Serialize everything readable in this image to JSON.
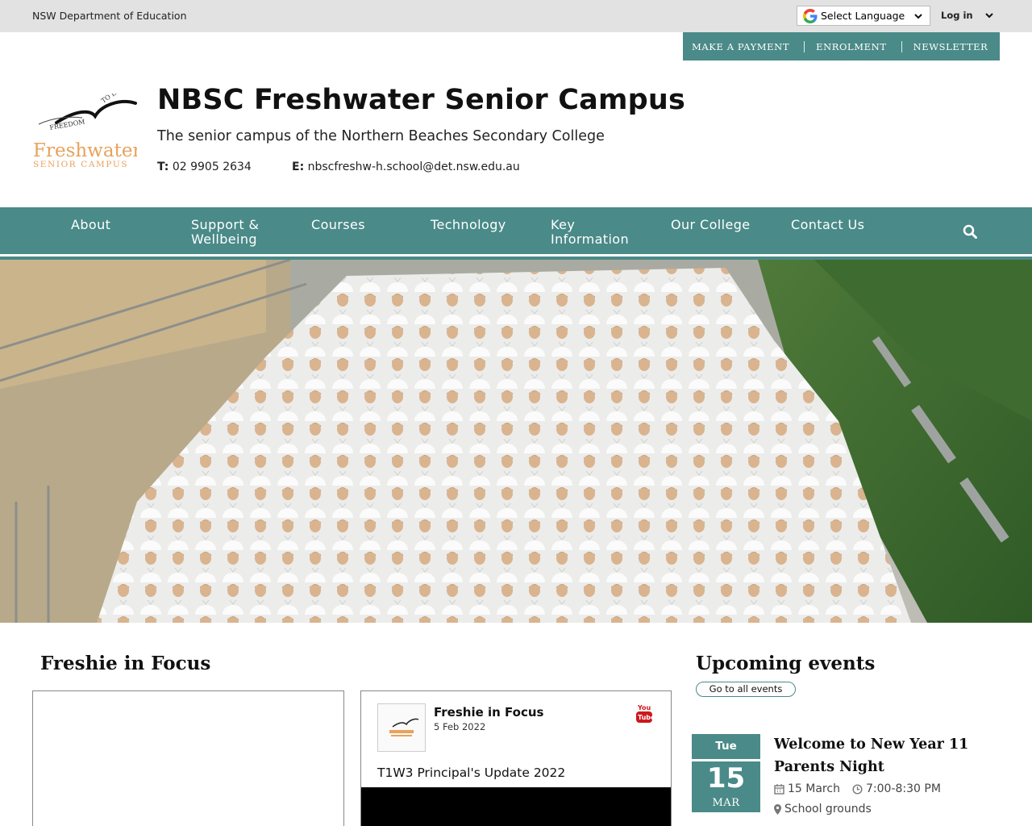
{
  "topbar": {
    "department": "NSW Department of Education",
    "language_label": "Select Language",
    "login_label": "Log in"
  },
  "quick_links": [
    "MAKE A PAYMENT",
    "ENROLMENT",
    "NEWSLETTER"
  ],
  "header": {
    "logo_words": [
      "FREEDOM",
      "TO LEARN",
      "Freshwater",
      "SENIOR CAMPUS"
    ],
    "title": "NBSC Freshwater Senior Campus",
    "tagline": "The senior campus of the Northern Beaches Secondary College",
    "phone_label": "T:",
    "phone": "02 9905 2634",
    "email_label": "E:",
    "email": "nbscfreshw-h.school@det.nsw.edu.au"
  },
  "nav": {
    "items": [
      "About",
      "Support & Wellbeing",
      "Courses",
      "Technology",
      "Key Information",
      "Our College",
      "Contact Us"
    ]
  },
  "focus": {
    "heading": "Freshie in Focus",
    "video": {
      "channel": "Freshie in Focus",
      "date": "5 Feb 2022",
      "caption": "T1W3 Principal's Update 2022"
    }
  },
  "events": {
    "heading": "Upcoming events",
    "all_link": "Go to all events",
    "items": [
      {
        "weekday": "Tue",
        "day": "15",
        "month": "MAR",
        "title": "Welcome to New Year 11 Parents Night",
        "date": "15 March",
        "time": "7:00-8:30 PM",
        "location": "School grounds"
      }
    ]
  },
  "colors": {
    "accent_teal": "#4a8a88",
    "topbar_grey": "#e2e2e2",
    "logo_orange": "#e8a25b"
  }
}
